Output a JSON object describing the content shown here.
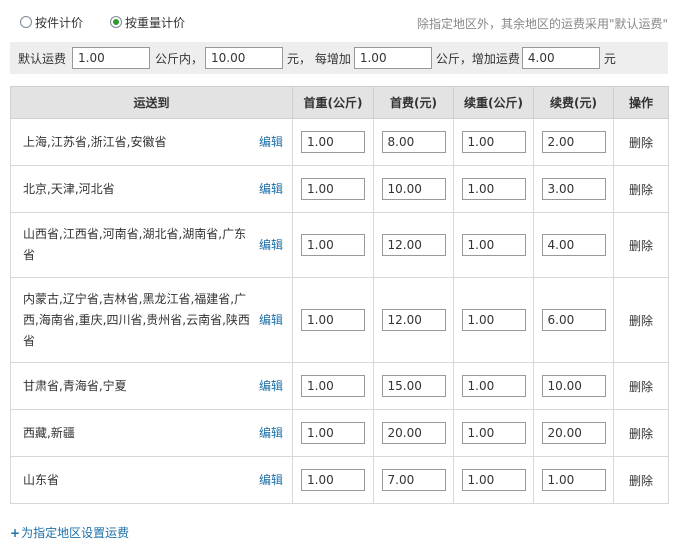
{
  "pricing_mode": {
    "options": [
      {
        "label": "按件计价",
        "selected": false
      },
      {
        "label": "按重量计价",
        "selected": true
      }
    ]
  },
  "note": "除指定地区外，其余地区的运费采用\"默认运费\"",
  "default_rate": {
    "label": "默认运费",
    "first_weight": "1.00",
    "unit_within": "公斤内，",
    "first_fee": "10.00",
    "yuan_each": "元， 每增加",
    "add_weight": "1.00",
    "unit_add": "公斤，增加运费",
    "add_fee": "4.00",
    "yuan": "元"
  },
  "table": {
    "headers": [
      "运送到",
      "首重(公斤)",
      "首费(元)",
      "续重(公斤)",
      "续费(元)",
      "操作"
    ],
    "edit_label": "编辑",
    "delete_label": "删除",
    "rows": [
      {
        "region": "上海,江苏省,浙江省,安徽省",
        "first_weight": "1.00",
        "first_fee": "8.00",
        "add_weight": "1.00",
        "add_fee": "2.00"
      },
      {
        "region": "北京,天津,河北省",
        "first_weight": "1.00",
        "first_fee": "10.00",
        "add_weight": "1.00",
        "add_fee": "3.00"
      },
      {
        "region": "山西省,江西省,河南省,湖北省,湖南省,广东省",
        "first_weight": "1.00",
        "first_fee": "12.00",
        "add_weight": "1.00",
        "add_fee": "4.00"
      },
      {
        "region": "内蒙古,辽宁省,吉林省,黑龙江省,福建省,广西,海南省,重庆,四川省,贵州省,云南省,陕西省",
        "first_weight": "1.00",
        "first_fee": "12.00",
        "add_weight": "1.00",
        "add_fee": "6.00"
      },
      {
        "region": "甘肃省,青海省,宁夏",
        "first_weight": "1.00",
        "first_fee": "15.00",
        "add_weight": "1.00",
        "add_fee": "10.00"
      },
      {
        "region": "西藏,新疆",
        "first_weight": "1.00",
        "first_fee": "20.00",
        "add_weight": "1.00",
        "add_fee": "20.00"
      },
      {
        "region": "山东省",
        "first_weight": "1.00",
        "first_fee": "7.00",
        "add_weight": "1.00",
        "add_fee": "1.00"
      }
    ]
  },
  "add_link": {
    "plus": "+",
    "label": "为指定地区设置运费"
  },
  "colors": {
    "link": "#1d6fa8",
    "header_bg": "#e3e3e3",
    "bar_bg": "#eeeeee",
    "radio_on": "#2f9a2f"
  }
}
